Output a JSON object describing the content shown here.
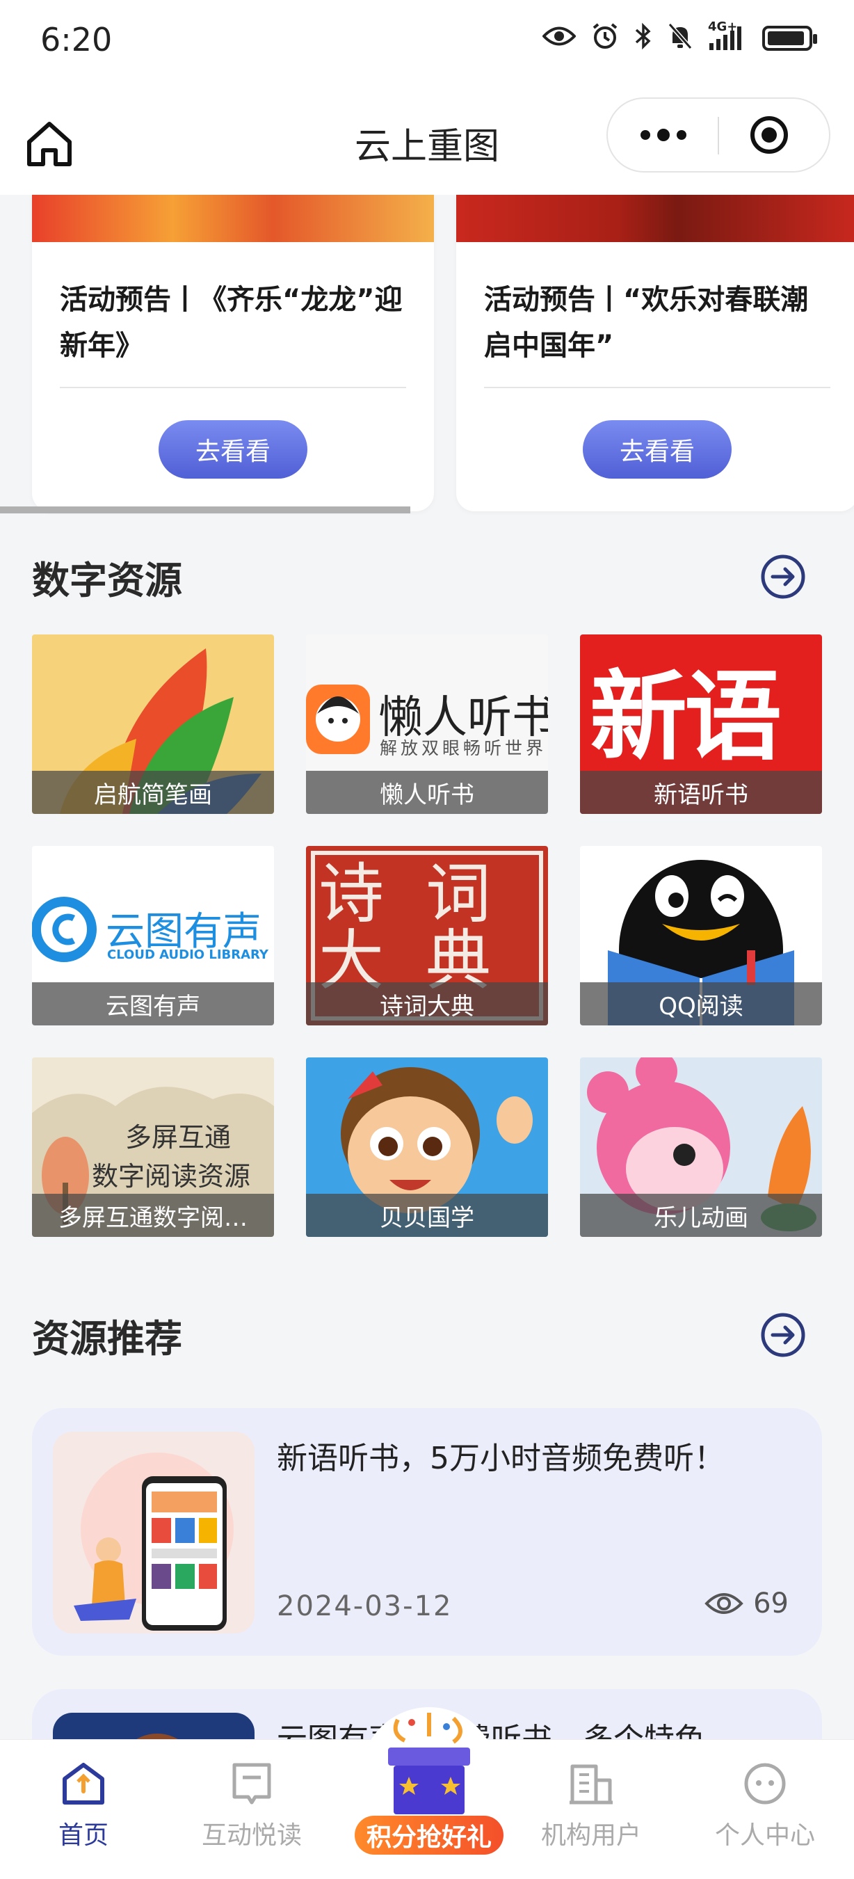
{
  "status_bar": {
    "time": "6:20",
    "network": "4G+"
  },
  "header": {
    "title": "云上重图"
  },
  "activity_cards": [
    {
      "title": "活动预告丨《齐乐“龙龙”迎新年》",
      "button": "去看看"
    },
    {
      "title": "活动预告丨“欢乐对春联潮启中国年”",
      "button": "去看看"
    }
  ],
  "digital_resources": {
    "title": "数字资源",
    "items": [
      {
        "label": "启航简笔画"
      },
      {
        "label": "懒人听书",
        "logo_text": "懒人听书",
        "logo_subtext": "解放双眼畅听世界"
      },
      {
        "label": "新语听书",
        "logo_text": "新语"
      },
      {
        "label": "云图有声",
        "logo_text": "云图有声",
        "logo_subtext": "CLOUD AUDIO LIBRARY"
      },
      {
        "label": "诗词大典",
        "logo_text": "诗词大典"
      },
      {
        "label": "QQ阅读"
      },
      {
        "label": "多屏互通数字阅…",
        "logo_text": "多屏互通",
        "logo_subtext": "数字阅读资源"
      },
      {
        "label": "贝贝国学"
      },
      {
        "label": "乐儿动画"
      }
    ]
  },
  "recommendations": {
    "title": "资源推荐",
    "items": [
      {
        "title": "新语听书，5万小时音频免费听！",
        "date": "2024-03-12",
        "views": "69"
      },
      {
        "title": "云图有声，免费听书，多个特色"
      }
    ]
  },
  "tab_bar": {
    "tabs": [
      {
        "label": "首页"
      },
      {
        "label": "互动悦读"
      },
      {
        "label": "机构用户"
      },
      {
        "label": "个人中心"
      }
    ],
    "promo_label": "积分抢好礼"
  },
  "colors": {
    "accent": "#2c3a9c",
    "button": "#5a6ae0",
    "card_bg": "#ecedfb"
  }
}
